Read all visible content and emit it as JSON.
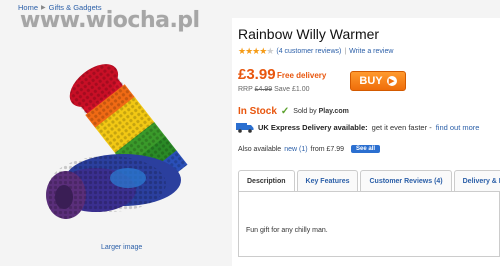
{
  "breadcrumb": {
    "home": "Home",
    "category": "Gifts & Gadgets"
  },
  "watermark": "www.wiocha.pl",
  "product": {
    "title": "Rainbow Willy Warmer",
    "rating_stars": 3.5,
    "reviews_label": "(4 customer reviews)",
    "write_review": "Write a review",
    "price": "£3.99",
    "free_delivery": "Free delivery",
    "rrp_label": "RRP",
    "rrp_value": "£4.99",
    "save": "Save £1.00",
    "buy_label": "BUY",
    "stock_label": "In Stock",
    "sold_by_prefix": "Sold by",
    "sold_by": "Play.com",
    "express_bold": "UK Express Delivery available:",
    "express_text": "get it even faster -",
    "find_out_more": "find out more",
    "also_prefix": "Also available",
    "also_new": "new (1)",
    "also_from": "from £7.99",
    "see_all": "See all",
    "larger_image": "Larger image"
  },
  "tabs": [
    {
      "label": "Description"
    },
    {
      "label": "Key Features"
    },
    {
      "label": "Customer Reviews (4)"
    },
    {
      "label": "Delivery & R"
    }
  ],
  "description_text": "Fun gift for any chilly man.",
  "colors": {
    "accent": "#e8560e",
    "link": "#2b5fa8",
    "buy": "#ef6d0a"
  }
}
